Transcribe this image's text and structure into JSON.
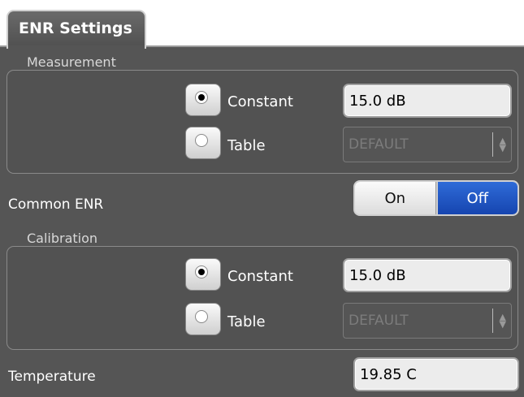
{
  "tab": {
    "title": "ENR Settings"
  },
  "measurement": {
    "group_label": "Measurement",
    "constant": {
      "label": "Constant",
      "checked": true,
      "value": "15.0 dB"
    },
    "table": {
      "label": "Table",
      "checked": false,
      "value": "DEFAULT"
    }
  },
  "common_enr": {
    "label": "Common ENR",
    "on_label": "On",
    "off_label": "Off",
    "selected": "Off"
  },
  "calibration": {
    "group_label": "Calibration",
    "constant": {
      "label": "Constant",
      "checked": true,
      "value": "15.0 dB"
    },
    "table": {
      "label": "Table",
      "checked": false,
      "value": "DEFAULT"
    }
  },
  "temperature": {
    "label": "Temperature",
    "value": "19.85 C"
  },
  "colors": {
    "panel_bg": "#555555",
    "accent_selected": "#1f56c4",
    "field_bg": "#ececec"
  }
}
